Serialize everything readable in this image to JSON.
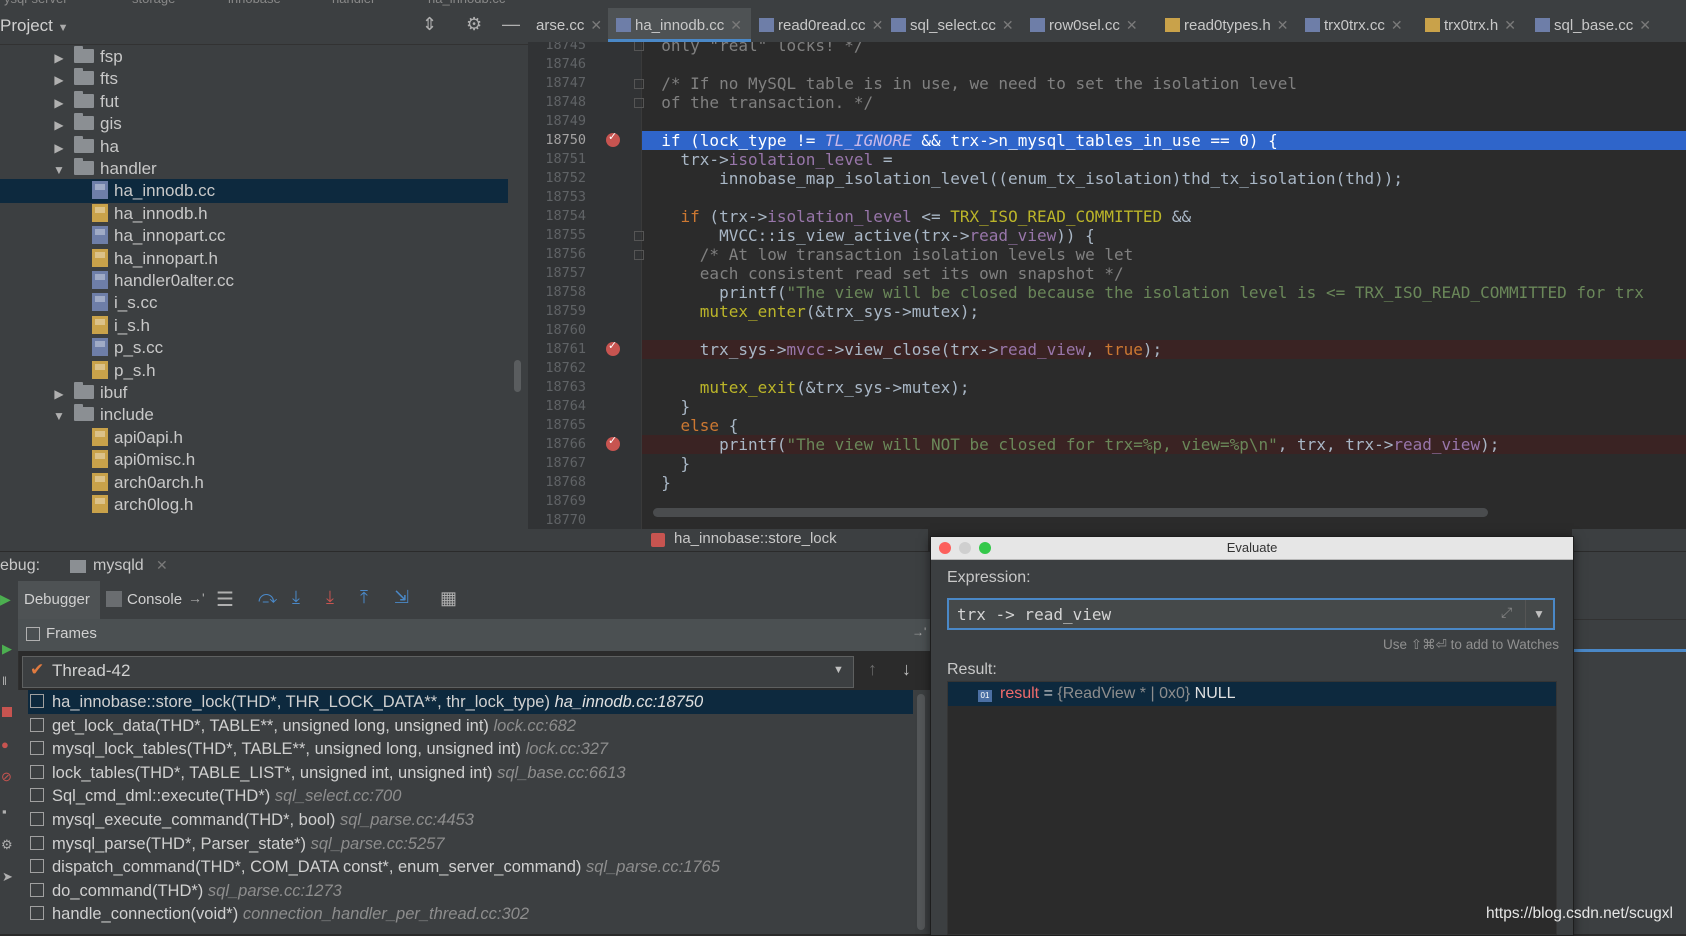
{
  "top_path": [
    "ysql-server",
    "storage",
    "innobase",
    "handler",
    "ha_innodb.cc"
  ],
  "project": {
    "title": "Project",
    "tree": [
      {
        "label": "fsp",
        "type": "folder",
        "expanded": false,
        "indent": 1
      },
      {
        "label": "fts",
        "type": "folder",
        "expanded": false,
        "indent": 1
      },
      {
        "label": "fut",
        "type": "folder",
        "expanded": false,
        "indent": 1
      },
      {
        "label": "gis",
        "type": "folder",
        "expanded": false,
        "indent": 1
      },
      {
        "label": "ha",
        "type": "folder",
        "expanded": false,
        "indent": 1
      },
      {
        "label": "handler",
        "type": "folder",
        "expanded": true,
        "indent": 1
      },
      {
        "label": "ha_innodb.cc",
        "type": "cc",
        "indent": 2,
        "selected": true
      },
      {
        "label": "ha_innodb.h",
        "type": "h",
        "indent": 2
      },
      {
        "label": "ha_innopart.cc",
        "type": "cc",
        "indent": 2
      },
      {
        "label": "ha_innopart.h",
        "type": "h",
        "indent": 2
      },
      {
        "label": "handler0alter.cc",
        "type": "cc",
        "indent": 2
      },
      {
        "label": "i_s.cc",
        "type": "cc",
        "indent": 2
      },
      {
        "label": "i_s.h",
        "type": "h",
        "indent": 2
      },
      {
        "label": "p_s.cc",
        "type": "cc",
        "indent": 2
      },
      {
        "label": "p_s.h",
        "type": "h",
        "indent": 2
      },
      {
        "label": "ibuf",
        "type": "folder",
        "expanded": false,
        "indent": 1
      },
      {
        "label": "include",
        "type": "folder",
        "expanded": true,
        "indent": 1
      },
      {
        "label": "api0api.h",
        "type": "h",
        "indent": 2
      },
      {
        "label": "api0misc.h",
        "type": "h",
        "indent": 2
      },
      {
        "label": "arch0arch.h",
        "type": "h",
        "indent": 2
      },
      {
        "label": "arch0log.h",
        "type": "h",
        "indent": 2
      }
    ]
  },
  "tabs": [
    {
      "label": "arse.cc",
      "type": "cc"
    },
    {
      "label": "ha_innodb.cc",
      "type": "cc",
      "active": true
    },
    {
      "label": "read0read.cc",
      "type": "cc"
    },
    {
      "label": "sql_select.cc",
      "type": "cc"
    },
    {
      "label": "row0sel.cc",
      "type": "cc"
    },
    {
      "label": "read0types.h",
      "type": "h"
    },
    {
      "label": "trx0trx.cc",
      "type": "cc"
    },
    {
      "label": "trx0trx.h",
      "type": "h"
    },
    {
      "label": "sql_base.cc",
      "type": "cc"
    }
  ],
  "editor": {
    "lines": [
      {
        "n": "18745",
        "html": "  <span class='cm'>only \"real\" locks! */</span>"
      },
      {
        "n": "18746",
        "html": ""
      },
      {
        "n": "18747",
        "html": "  <span class='cm'>/* If no MySQL table is in use, we need to set the isolation level</span>"
      },
      {
        "n": "18748",
        "html": "  <span class='cm'>of the transaction. */</span>"
      },
      {
        "n": "18749",
        "html": ""
      },
      {
        "n": "18750",
        "html": "  if (lock_type != <i>TL_IGNORE</i> &amp;&amp; trx->n_mysql_tables_in_use == 0) {",
        "hl": true,
        "bp": true
      },
      {
        "n": "18751",
        "html": "    trx-><span class='fld'>isolation_level</span> ="
      },
      {
        "n": "18752",
        "html": "        innobase_map_isolation_level((enum_tx_isolation)thd_tx_isolation(thd));"
      },
      {
        "n": "18753",
        "html": ""
      },
      {
        "n": "18754",
        "html": "    <span class='kw'>if</span> (trx-><span class='fld'>isolation_level</span> &lt;= <span class='mac'>TRX_ISO_READ_COMMITTED</span> &amp;&amp;"
      },
      {
        "n": "18755",
        "html": "        MVCC::is_view_active(trx-><span class='fld'>read_view</span>)) {"
      },
      {
        "n": "18756",
        "html": "      <span class='cm'>/* At low transaction isolation levels we let</span>"
      },
      {
        "n": "18757",
        "html": "      <span class='cm'>each consistent read set its own snapshot */</span>"
      },
      {
        "n": "18758",
        "html": "        printf(<span class='str'>\"The view will be closed because the isolation level is &lt;= TRX_ISO_READ_COMMITTED for trx</span>"
      },
      {
        "n": "18759",
        "html": "      <span class='mac'>mutex_enter</span>(&amp;trx_sys->mutex);"
      },
      {
        "n": "18760",
        "html": ""
      },
      {
        "n": "18761",
        "html": "      trx_sys-><span class='fld'>mvcc</span>->view_close(trx-><span class='fld'>read_view</span>, <span class='kw'>true</span>);",
        "bp": true,
        "bph": true
      },
      {
        "n": "18762",
        "html": ""
      },
      {
        "n": "18763",
        "html": "      <span class='mac'>mutex_exit</span>(&amp;trx_sys->mutex);"
      },
      {
        "n": "18764",
        "html": "    }"
      },
      {
        "n": "18765",
        "html": "    <span class='kw'>else</span> {"
      },
      {
        "n": "18766",
        "html": "        printf(<span class='str'>\"The view will NOT be closed for trx=%p, view=%p\\n\"</span>, trx, trx-><span class='fld'>read_view</span>);",
        "bp": true,
        "bph": true
      },
      {
        "n": "18767",
        "html": "    }"
      },
      {
        "n": "18768",
        "html": "  }"
      },
      {
        "n": "18769",
        "html": ""
      },
      {
        "n": "18770",
        "html": ""
      }
    ],
    "current_line": "18750"
  },
  "breadcrumb": "ha_innobase::store_lock",
  "debug": {
    "label": "ebug:",
    "session": "mysqld",
    "tabs": {
      "debugger": "Debugger",
      "console": "Console"
    },
    "frames_title": "Frames",
    "thread": "Thread-42",
    "frames": [
      {
        "fn": "ha_innobase::store_lock(THD*, THR_LOCK_DATA**, thr_lock_type)",
        "loc": "ha_innodb.cc:18750",
        "selected": true
      },
      {
        "fn": "get_lock_data(THD*, TABLE**, unsigned long, unsigned int)",
        "loc": "lock.cc:682"
      },
      {
        "fn": "mysql_lock_tables(THD*, TABLE**, unsigned long, unsigned int)",
        "loc": "lock.cc:327"
      },
      {
        "fn": "lock_tables(THD*, TABLE_LIST*, unsigned int, unsigned int)",
        "loc": "sql_base.cc:6613"
      },
      {
        "fn": "Sql_cmd_dml::execute(THD*)",
        "loc": "sql_select.cc:700"
      },
      {
        "fn": "mysql_execute_command(THD*, bool)",
        "loc": "sql_parse.cc:4453"
      },
      {
        "fn": "mysql_parse(THD*, Parser_state*)",
        "loc": "sql_parse.cc:5257"
      },
      {
        "fn": "dispatch_command(THD*, COM_DATA const*, enum_server_command)",
        "loc": "sql_parse.cc:1765"
      },
      {
        "fn": "do_command(THD*)",
        "loc": "sql_parse.cc:1273"
      },
      {
        "fn": "handle_connection(void*)",
        "loc": "connection_handler_per_thread.cc:302"
      }
    ]
  },
  "evaluate": {
    "title": "Evaluate",
    "expression_label": "Expression:",
    "expression": "trx -> read_view",
    "watch_hint": "Use ⇧⌘⏎ to add to Watches",
    "result_label": "Result:",
    "result_name": "result",
    "result_eq": " = ",
    "result_type": "{ReadView * | 0x0}",
    "result_value": " NULL"
  },
  "watermark": "https://blog.csdn.net/scugxl",
  "colors": {
    "accent": "#4a88c7",
    "selection": "#0d293e",
    "breakpoint": "#c75450",
    "current_line": "#2f65ca"
  }
}
